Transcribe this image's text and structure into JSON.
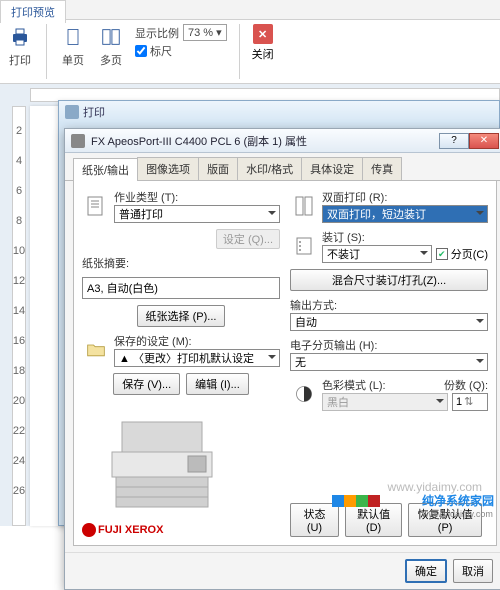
{
  "ribbon": {
    "tab": "打印预览",
    "print": "打印",
    "single": "单页",
    "multi": "多页",
    "zoom_label": "显示比例",
    "zoom_value": "73 %",
    "ruler_chk": "标尺",
    "close": "关闭"
  },
  "ruler_v": [
    "2",
    "4",
    "6",
    "8",
    "10",
    "12",
    "14",
    "16",
    "18",
    "20",
    "22",
    "24",
    "26"
  ],
  "innerwin": {
    "title": "打印"
  },
  "dialog": {
    "title": "FX ApeosPort-III C4400 PCL 6 (副本 1) 属性",
    "tabs": [
      "纸张/输出",
      "图像选项",
      "版面",
      "水印/格式",
      "具体设定",
      "传真"
    ],
    "active_tab": 0,
    "left": {
      "jobtype_label": "作业类型 (T):",
      "jobtype_value": "普通打印",
      "jobtype_settings_btn": "设定 (Q)...",
      "summary_label": "纸张摘要:",
      "summary_value": "A3, 自动(白色)",
      "paper_select_btn": "纸张选择 (P)...",
      "saved_label": "保存的设定 (M):",
      "saved_value": "〈更改〉打印机默认设定",
      "save_btn": "保存 (V)...",
      "edit_btn": "编辑 (I)...",
      "brand": "FUJI XEROX"
    },
    "right": {
      "duplex_label": "双面打印 (R):",
      "duplex_value": "双面打印，短边装订",
      "bind_label": "装订 (S):",
      "bind_value": "不装订",
      "collate_chk": "分页(C)",
      "mixed_btn": "混合尺寸装订/打孔(Z)...",
      "output_label": "输出方式:",
      "output_value": "自动",
      "ecollate_label": "电子分页输出 (H):",
      "ecollate_value": "无",
      "colormode_label": "色彩模式 (L):",
      "colormode_value": "黑白",
      "copies_label": "份数 (Q):",
      "copies_value": "1"
    },
    "bottom": {
      "status_btn": "状态 (U)",
      "defaults_btn": "默认值 (D)",
      "restore_btn": "恢复默认值 (P)"
    },
    "footer": {
      "ok": "确定",
      "cancel": "取消"
    }
  },
  "watermarks": {
    "wm1a": "纯净系统家园",
    "wm1b": "www.yidaimy.com",
    "wm2": "www.yidaimy.com"
  },
  "colors": [
    "#1e87e6",
    "#ff9b00",
    "#3bb54a",
    "#c02222"
  ]
}
